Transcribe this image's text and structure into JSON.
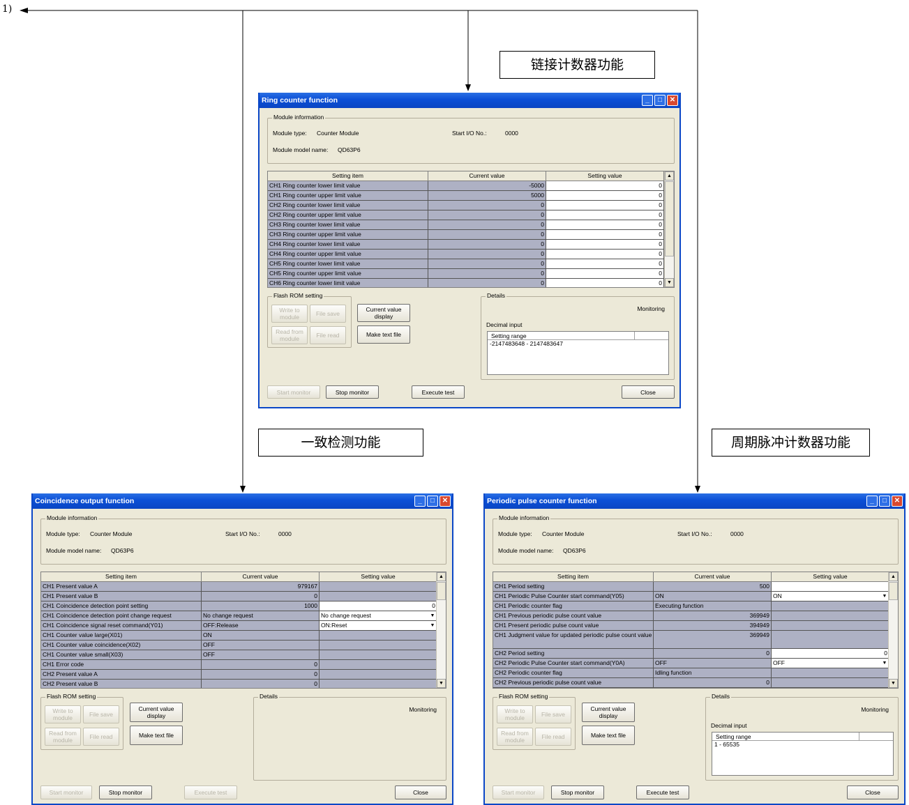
{
  "diagram": {
    "step_label": "1)",
    "captions": {
      "ring": "链接计数器功能",
      "coincidence": "一致检测功能",
      "periodic": "周期脉冲计数器功能"
    }
  },
  "common": {
    "module_info_label": "Module information",
    "module_type_label": "Module type:",
    "module_type": "Counter Module",
    "start_io_label": "Start I/O No.:",
    "start_io": "0000",
    "model_name_label": "Module model name:",
    "model_name": "QD63P6",
    "col_item": "Setting item",
    "col_current": "Current value",
    "col_setting": "Setting value",
    "flash_rom_label": "Flash ROM setting",
    "write_to_module": "Write to module",
    "file_save": "File save",
    "read_from_module": "Read from module",
    "file_read": "File read",
    "current_value_display": "Current value display",
    "make_text_file": "Make text file",
    "details_label": "Details",
    "monitoring": "Monitoring",
    "decimal_input": "Decimal input",
    "setting_range_label": "Setting range",
    "start_monitor": "Start monitor",
    "stop_monitor": "Stop monitor",
    "execute_test": "Execute test",
    "close": "Close",
    "icons": [
      "minimize-icon",
      "maximize-icon",
      "close-icon",
      "scroll-up-icon",
      "scroll-down-icon",
      "dropdown-arrow-icon"
    ]
  },
  "ring": {
    "title": "Ring counter function",
    "range_value": "-2147483648 - 2147483647",
    "rows": [
      {
        "item": "CH1 Ring counter lower limit value",
        "current": "-5000",
        "setting": "0"
      },
      {
        "item": "CH1 Ring counter upper limit value",
        "current": "5000",
        "setting": "0"
      },
      {
        "item": "CH2 Ring counter lower limit value",
        "current": "0",
        "setting": "0"
      },
      {
        "item": "CH2 Ring counter upper limit value",
        "current": "0",
        "setting": "0"
      },
      {
        "item": "CH3 Ring counter lower limit value",
        "current": "0",
        "setting": "0"
      },
      {
        "item": "CH3 Ring counter upper limit value",
        "current": "0",
        "setting": "0"
      },
      {
        "item": "CH4 Ring counter lower limit value",
        "current": "0",
        "setting": "0"
      },
      {
        "item": "CH4 Ring counter upper limit value",
        "current": "0",
        "setting": "0"
      },
      {
        "item": "CH5 Ring counter lower limit value",
        "current": "0",
        "setting": "0"
      },
      {
        "item": "CH5 Ring counter upper limit value",
        "current": "0",
        "setting": "0"
      },
      {
        "item": "CH6 Ring counter lower limit value",
        "current": "0",
        "setting": "0"
      }
    ]
  },
  "coincidence": {
    "title": "Coincidence output function",
    "rows": [
      {
        "item": "CH1 Present value A",
        "current": "979167",
        "setting": ""
      },
      {
        "item": "CH1 Present value B",
        "current": "0",
        "setting": ""
      },
      {
        "item": "CH1 Coincidence detection point setting",
        "current": "1000",
        "setting": "0"
      },
      {
        "item": "CH1 Coincidence detection point change request",
        "current": "No change request",
        "setting": "No change request"
      },
      {
        "item": "CH1 Coincidence signal reset command(Y01)",
        "current": "OFF:Release",
        "setting": "ON:Reset"
      },
      {
        "item": "CH1 Counter value large(X01)",
        "current": "ON",
        "setting": ""
      },
      {
        "item": "CH1 Counter value coincidence(X02)",
        "current": "OFF",
        "setting": ""
      },
      {
        "item": "CH1 Counter value small(X03)",
        "current": "OFF",
        "setting": ""
      },
      {
        "item": "CH1 Error code",
        "current": "0",
        "setting": ""
      },
      {
        "item": "CH2 Present value A",
        "current": "0",
        "setting": ""
      },
      {
        "item": "CH2 Present value B",
        "current": "0",
        "setting": ""
      }
    ]
  },
  "periodic": {
    "title": "Periodic pulse counter function",
    "range_value": "1 - 65535",
    "rows": [
      {
        "item": "CH1 Period setting",
        "current": "500",
        "setting": ""
      },
      {
        "item": "CH1 Periodic Pulse Counter start command(Y05)",
        "current": "ON",
        "setting": "ON"
      },
      {
        "item": "CH1 Periodic counter flag",
        "current": "Executing function",
        "setting": ""
      },
      {
        "item": "CH1 Previous periodic pulse count value",
        "current": "369949",
        "setting": ""
      },
      {
        "item": "CH1 Present periodic pulse count value",
        "current": "394949",
        "setting": ""
      },
      {
        "item": "CH1 Judgment value for updated periodic pulse count value",
        "current": "369949",
        "setting": ""
      },
      {
        "item": "CH2 Period setting",
        "current": "0",
        "setting": "0"
      },
      {
        "item": "CH2 Periodic Pulse Counter start command(Y0A)",
        "current": "OFF",
        "setting": "OFF"
      },
      {
        "item": "CH2 Periodic counter flag",
        "current": "Idling function",
        "setting": ""
      },
      {
        "item": "CH2 Previous periodic pulse count value",
        "current": "0",
        "setting": ""
      }
    ]
  }
}
